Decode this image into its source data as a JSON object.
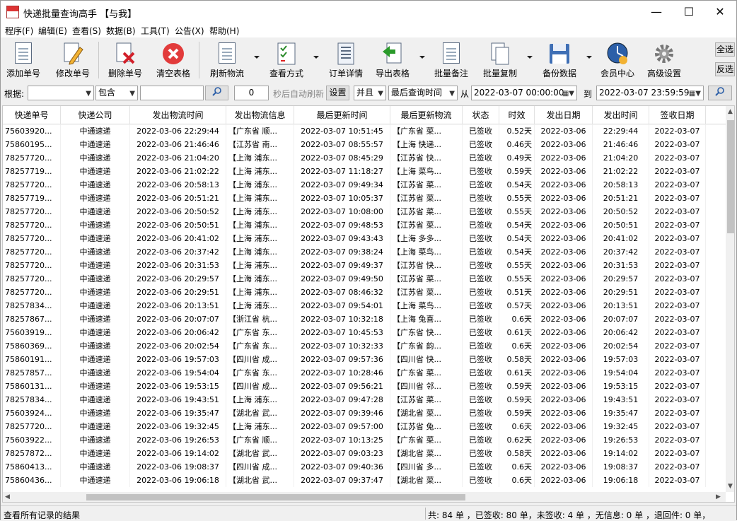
{
  "window": {
    "title": "快递批量查询高手 【与我】"
  },
  "menu": [
    "程序(F)",
    "编辑(E)",
    "查看(S)",
    "数据(B)",
    "工具(T)",
    "公告(X)",
    "帮助(H)"
  ],
  "toolbar": {
    "add": "添加单号",
    "edit": "修改单号",
    "delete": "删除单号",
    "clear": "清空表格",
    "refresh": "刷新物流",
    "view_mode": "查看方式",
    "order_detail": "订单详情",
    "export": "导出表格",
    "batch_note": "批量备注",
    "batch_copy": "批量复制",
    "backup": "备份数据",
    "member": "会员中心",
    "advanced": "高级设置",
    "select_all": "全选",
    "invert": "反选"
  },
  "filter": {
    "by_label": "根据:",
    "by_value": "",
    "contains": "包含",
    "keyword": "",
    "seconds": "0",
    "auto_refresh_label": "秒后自动刷新",
    "set_btn": "设置",
    "join": "并且",
    "time_field": "最后查询时间",
    "from_label": "从",
    "from": "2022-03-07 00:00:00",
    "to_label": "到",
    "to": "2022-03-07 23:59:59"
  },
  "table": {
    "columns": [
      "快递单号",
      "快递公司",
      "发出物流时间",
      "发出物流信息",
      "最后更新时间",
      "最后更新物流",
      "状态",
      "时效",
      "发出日期",
      "发出时间",
      "签收日期"
    ],
    "rows": [
      [
        "75603920...",
        "中通速递",
        "2022-03-06 22:29:44",
        "【广东省 顺...",
        "2022-03-07 10:51:45",
        "【广东省 菜...",
        "已签收",
        "0.52天",
        "2022-03-06",
        "22:29:44",
        "2022-03-07"
      ],
      [
        "75860195...",
        "中通速递",
        "2022-03-06 21:46:46",
        "【江苏省 南...",
        "2022-03-07 08:55:57",
        "【上海 快递...",
        "已签收",
        "0.46天",
        "2022-03-06",
        "21:46:46",
        "2022-03-07"
      ],
      [
        "78257720...",
        "中通速递",
        "2022-03-06 21:04:20",
        "【上海 浦东...",
        "2022-03-07 08:45:29",
        "【江苏省 快...",
        "已签收",
        "0.49天",
        "2022-03-06",
        "21:04:20",
        "2022-03-07"
      ],
      [
        "78257719...",
        "中通速递",
        "2022-03-06 21:02:22",
        "【上海 浦东...",
        "2022-03-07 11:18:27",
        "【上海 菜鸟...",
        "已签收",
        "0.59天",
        "2022-03-06",
        "21:02:22",
        "2022-03-07"
      ],
      [
        "78257720...",
        "中通速递",
        "2022-03-06 20:58:13",
        "【上海 浦东...",
        "2022-03-07 09:49:34",
        "【江苏省 菜...",
        "已签收",
        "0.54天",
        "2022-03-06",
        "20:58:13",
        "2022-03-07"
      ],
      [
        "78257719...",
        "中通速递",
        "2022-03-06 20:51:21",
        "【上海 浦东...",
        "2022-03-07 10:05:37",
        "【江苏省 菜...",
        "已签收",
        "0.55天",
        "2022-03-06",
        "20:51:21",
        "2022-03-07"
      ],
      [
        "78257720...",
        "中通速递",
        "2022-03-06 20:50:52",
        "【上海 浦东...",
        "2022-03-07 10:08:00",
        "【江苏省 菜...",
        "已签收",
        "0.55天",
        "2022-03-06",
        "20:50:52",
        "2022-03-07"
      ],
      [
        "78257720...",
        "中通速递",
        "2022-03-06 20:50:51",
        "【上海 浦东...",
        "2022-03-07 09:48:53",
        "【江苏省 菜...",
        "已签收",
        "0.54天",
        "2022-03-06",
        "20:50:51",
        "2022-03-07"
      ],
      [
        "78257720...",
        "中通速递",
        "2022-03-06 20:41:02",
        "【上海 浦东...",
        "2022-03-07 09:43:43",
        "【上海 多多...",
        "已签收",
        "0.54天",
        "2022-03-06",
        "20:41:02",
        "2022-03-07"
      ],
      [
        "78257720...",
        "中通速递",
        "2022-03-06 20:37:42",
        "【上海 浦东...",
        "2022-03-07 09:38:24",
        "【上海 菜鸟...",
        "已签收",
        "0.54天",
        "2022-03-06",
        "20:37:42",
        "2022-03-07"
      ],
      [
        "78257720...",
        "中通速递",
        "2022-03-06 20:31:53",
        "【上海 浦东...",
        "2022-03-07 09:49:37",
        "【江苏省 快...",
        "已签收",
        "0.55天",
        "2022-03-06",
        "20:31:53",
        "2022-03-07"
      ],
      [
        "78257720...",
        "中通速递",
        "2022-03-06 20:29:57",
        "【上海 浦东...",
        "2022-03-07 09:49:50",
        "【江苏省 菜...",
        "已签收",
        "0.55天",
        "2022-03-06",
        "20:29:57",
        "2022-03-07"
      ],
      [
        "78257720...",
        "中通速递",
        "2022-03-06 20:29:51",
        "【上海 浦东...",
        "2022-03-07 08:46:32",
        "【江苏省 菜...",
        "已签收",
        "0.51天",
        "2022-03-06",
        "20:29:51",
        "2022-03-07"
      ],
      [
        "78257834...",
        "中通速递",
        "2022-03-06 20:13:51",
        "【上海 浦东...",
        "2022-03-07 09:54:01",
        "【上海 菜鸟...",
        "已签收",
        "0.57天",
        "2022-03-06",
        "20:13:51",
        "2022-03-07"
      ],
      [
        "78257867...",
        "中通速递",
        "2022-03-06 20:07:07",
        "【浙江省 杭...",
        "2022-03-07 10:32:18",
        "【上海 兔喜...",
        "已签收",
        "0.6天",
        "2022-03-06",
        "20:07:07",
        "2022-03-07"
      ],
      [
        "75603919...",
        "中通速递",
        "2022-03-06 20:06:42",
        "【广东省 东...",
        "2022-03-07 10:45:53",
        "【广东省 快...",
        "已签收",
        "0.61天",
        "2022-03-06",
        "20:06:42",
        "2022-03-07"
      ],
      [
        "75860369...",
        "中通速递",
        "2022-03-06 20:02:54",
        "【广东省 东...",
        "2022-03-07 10:32:33",
        "【广东省 韵...",
        "已签收",
        "0.6天",
        "2022-03-06",
        "20:02:54",
        "2022-03-07"
      ],
      [
        "75860191...",
        "中通速递",
        "2022-03-06 19:57:03",
        "【四川省 成...",
        "2022-03-07 09:57:36",
        "【四川省 快...",
        "已签收",
        "0.58天",
        "2022-03-06",
        "19:57:03",
        "2022-03-07"
      ],
      [
        "78257857...",
        "中通速递",
        "2022-03-06 19:54:04",
        "【广东省 东...",
        "2022-03-07 10:28:46",
        "【广东省 菜...",
        "已签收",
        "0.61天",
        "2022-03-06",
        "19:54:04",
        "2022-03-07"
      ],
      [
        "75860131...",
        "中通速递",
        "2022-03-06 19:53:15",
        "【四川省 成...",
        "2022-03-07 09:56:21",
        "【四川省 邻...",
        "已签收",
        "0.59天",
        "2022-03-06",
        "19:53:15",
        "2022-03-07"
      ],
      [
        "78257834...",
        "中通速递",
        "2022-03-06 19:43:51",
        "【上海 浦东...",
        "2022-03-07 09:47:28",
        "【江苏省 菜...",
        "已签收",
        "0.59天",
        "2022-03-06",
        "19:43:51",
        "2022-03-07"
      ],
      [
        "75603924...",
        "中通速递",
        "2022-03-06 19:35:47",
        "【湖北省 武...",
        "2022-03-07 09:39:46",
        "【湖北省 菜...",
        "已签收",
        "0.59天",
        "2022-03-06",
        "19:35:47",
        "2022-03-07"
      ],
      [
        "78257720...",
        "中通速递",
        "2022-03-06 19:32:45",
        "【上海 浦东...",
        "2022-03-07 09:57:00",
        "【江苏省 兔...",
        "已签收",
        "0.6天",
        "2022-03-06",
        "19:32:45",
        "2022-03-07"
      ],
      [
        "75603922...",
        "中通速递",
        "2022-03-06 19:26:53",
        "【广东省 顺...",
        "2022-03-07 10:13:25",
        "【广东省 菜...",
        "已签收",
        "0.62天",
        "2022-03-06",
        "19:26:53",
        "2022-03-07"
      ],
      [
        "78257872...",
        "中通速递",
        "2022-03-06 19:14:02",
        "【湖北省 武...",
        "2022-03-07 09:03:23",
        "【湖北省 菜...",
        "已签收",
        "0.58天",
        "2022-03-06",
        "19:14:02",
        "2022-03-07"
      ],
      [
        "75860413...",
        "中通速递",
        "2022-03-06 19:08:37",
        "【四川省 成...",
        "2022-03-07 09:40:36",
        "【四川省 多...",
        "已签收",
        "0.6天",
        "2022-03-06",
        "19:08:37",
        "2022-03-07"
      ],
      [
        "75860436...",
        "中通速递",
        "2022-03-06 19:06:18",
        "【湖北省 武...",
        "2022-03-07 09:37:47",
        "【湖北省 菜...",
        "已签收",
        "0.6天",
        "2022-03-06",
        "19:06:18",
        "2022-03-07"
      ]
    ]
  },
  "status": {
    "left": "查看所有记录的结果",
    "right": "共: 84 单 ，已签收:  80 单，未签收:  4 单 ，无信息: 0 单 ，退回件: 0 单，"
  }
}
